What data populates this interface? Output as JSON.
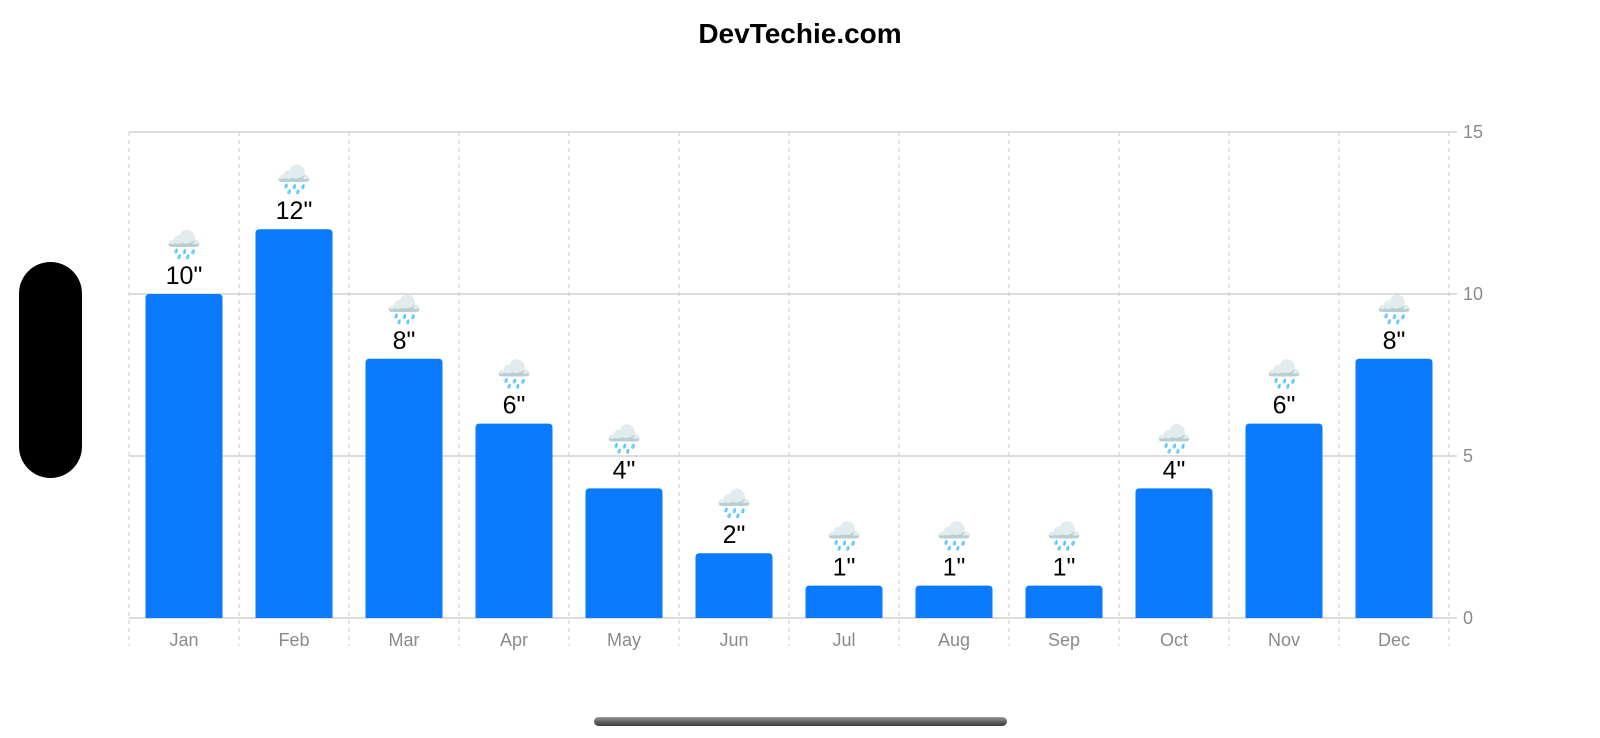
{
  "title": "DevTechie.com",
  "chart_data": {
    "type": "bar",
    "title": "DevTechie.com",
    "xlabel": "",
    "ylabel": "",
    "categories": [
      "Jan",
      "Feb",
      "Mar",
      "Apr",
      "May",
      "Jun",
      "Jul",
      "Aug",
      "Sep",
      "Oct",
      "Nov",
      "Dec"
    ],
    "values": [
      10,
      12,
      8,
      6,
      4,
      2,
      1,
      1,
      1,
      4,
      6,
      8
    ],
    "value_labels": [
      "10\"",
      "12\"",
      "8\"",
      "6\"",
      "4\"",
      "2\"",
      "1\"",
      "1\"",
      "1\"",
      "4\"",
      "6\"",
      "8\""
    ],
    "annotation_icon": "cloud-with-rain-icon",
    "annotation_glyph": "🌧️",
    "ylim": [
      0,
      15
    ],
    "yticks": [
      0,
      5,
      10,
      15
    ],
    "y_axis_position": "right",
    "grid": true,
    "bar_color": "#0A7AFF",
    "grid_color": "#C8C8C8",
    "tick_label_color": "#8A8A8E"
  }
}
